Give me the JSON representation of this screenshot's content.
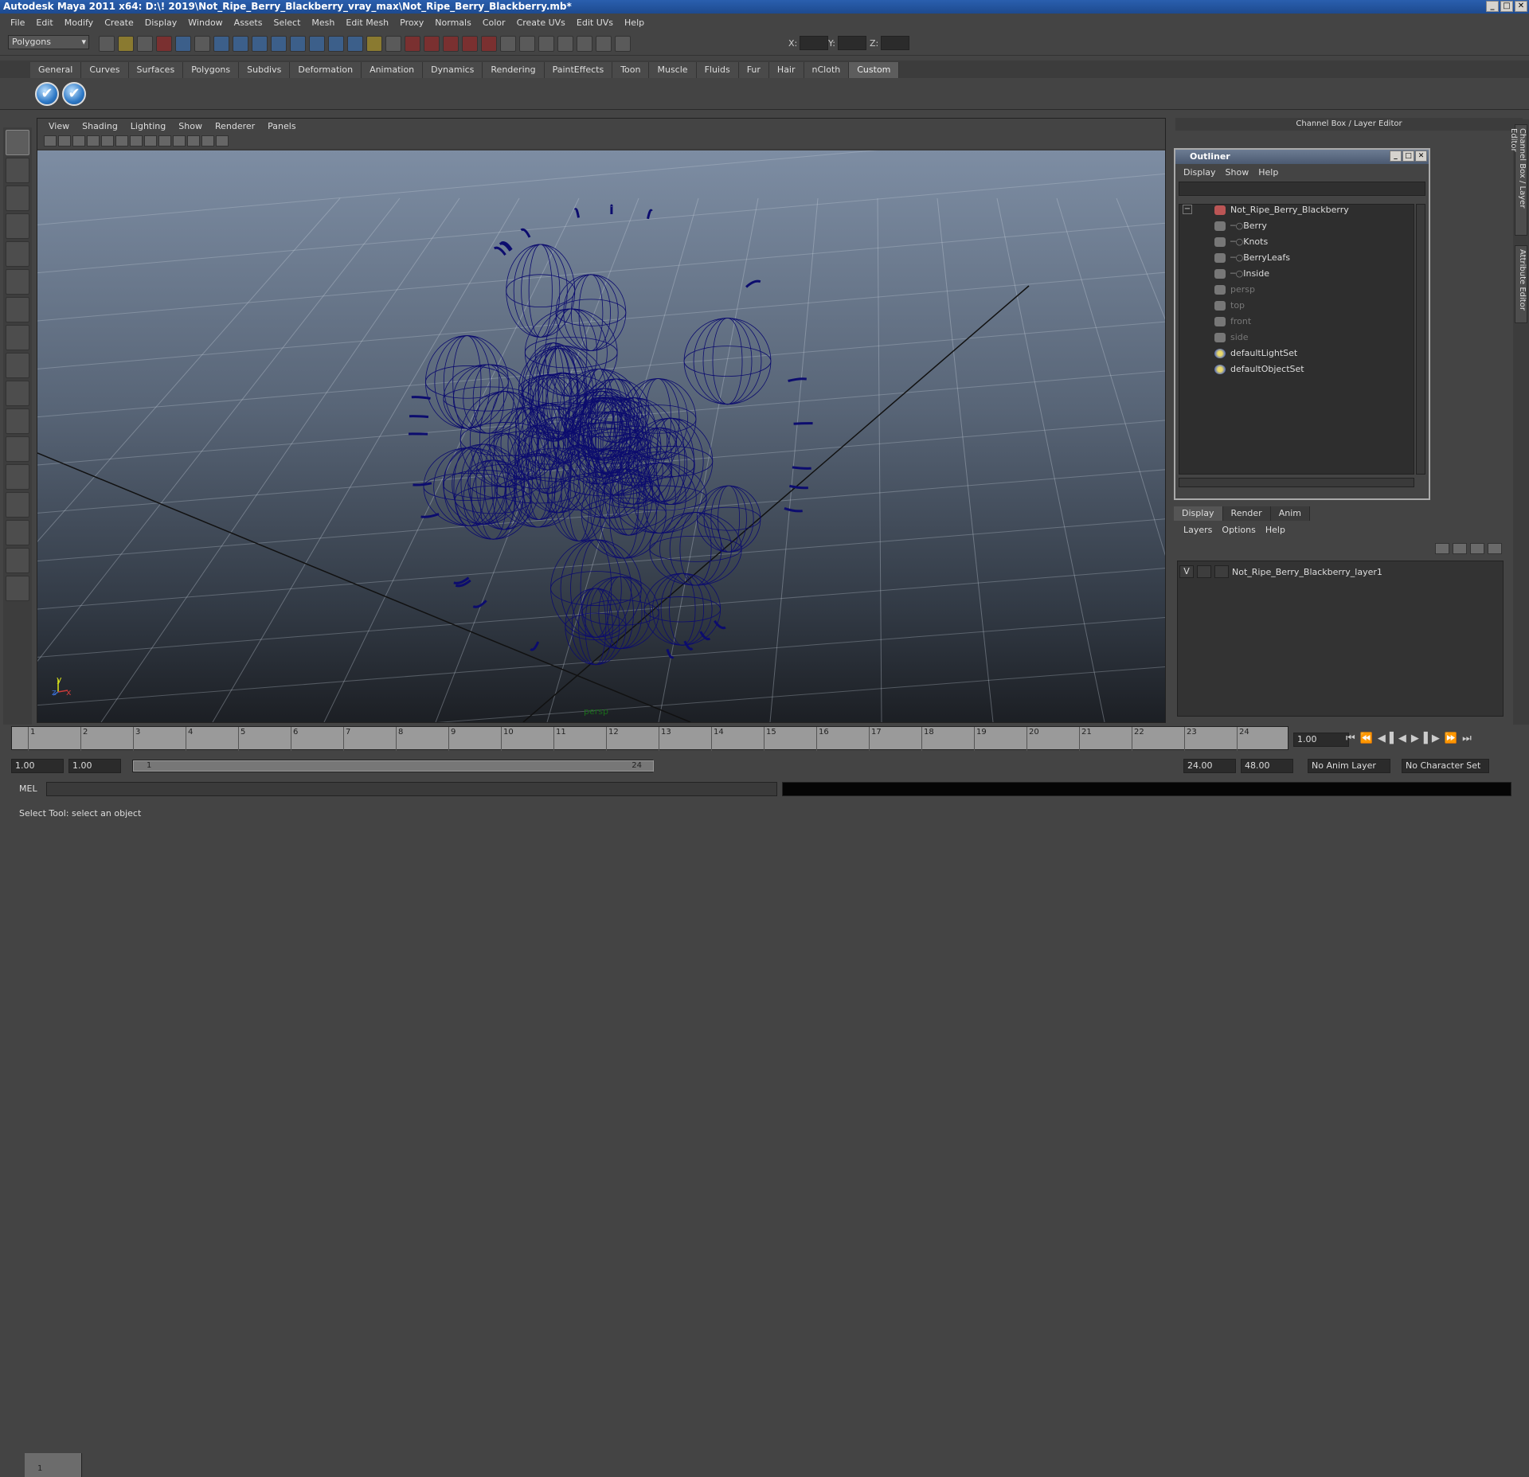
{
  "window": {
    "title": "Autodesk Maya 2011 x64: D:\\! 2019\\Not_Ripe_Berry_Blackberry_vray_max\\Not_Ripe_Berry_Blackberry.mb*",
    "min": "_",
    "max": "□",
    "close": "✕"
  },
  "menu": [
    "File",
    "Edit",
    "Modify",
    "Create",
    "Display",
    "Window",
    "Assets",
    "Select",
    "Mesh",
    "Edit Mesh",
    "Proxy",
    "Normals",
    "Color",
    "Create UVs",
    "Edit UVs",
    "Help"
  ],
  "status": {
    "mode": "Polygons",
    "x_label": "X:",
    "y_label": "Y:",
    "z_label": "Z:"
  },
  "shelf": {
    "tabs": [
      "General",
      "Curves",
      "Surfaces",
      "Polygons",
      "Subdivs",
      "Deformation",
      "Animation",
      "Dynamics",
      "Rendering",
      "PaintEffects",
      "Toon",
      "Muscle",
      "Fluids",
      "Fur",
      "Hair",
      "nCloth",
      "Custom"
    ],
    "active": "Custom",
    "buttons": [
      "✔",
      "✔"
    ]
  },
  "viewport": {
    "menu": [
      "View",
      "Shading",
      "Lighting",
      "Show",
      "Renderer",
      "Panels"
    ],
    "camera": "persp",
    "axis_y": "y",
    "axis_x": "x",
    "axis_z": "z",
    "wire_color": "#0c0c6e"
  },
  "channel_box_title": "Channel Box / Layer Editor",
  "outliner": {
    "title": "Outliner",
    "menu": [
      "Display",
      "Show",
      "Help"
    ],
    "items": [
      {
        "label": "Not_Ripe_Berry_Blackberry",
        "dim": false
      },
      {
        "label": "Berry",
        "dim": false
      },
      {
        "label": "Knots",
        "dim": false
      },
      {
        "label": "BerryLeafs",
        "dim": false
      },
      {
        "label": "Inside",
        "dim": false
      },
      {
        "label": "persp",
        "dim": true
      },
      {
        "label": "top",
        "dim": true
      },
      {
        "label": "front",
        "dim": true
      },
      {
        "label": "side",
        "dim": true
      },
      {
        "label": "defaultLightSet",
        "dim": false
      },
      {
        "label": "defaultObjectSet",
        "dim": false
      }
    ],
    "expander": "−"
  },
  "layers": {
    "tabs": [
      "Display",
      "Render",
      "Anim"
    ],
    "active": "Display",
    "menu": [
      "Layers",
      "Options",
      "Help"
    ],
    "row": {
      "visible": "V",
      "name": "Not_Ripe_Berry_Blackberry_layer1"
    }
  },
  "side_tabs": [
    "Channel Box / Layer Editor",
    "Attribute Editor"
  ],
  "timeline": {
    "ticks": [
      "1",
      "2",
      "3",
      "4",
      "5",
      "6",
      "7",
      "8",
      "9",
      "10",
      "11",
      "12",
      "13",
      "14",
      "15",
      "16",
      "17",
      "18",
      "19",
      "20",
      "21",
      "22",
      "23",
      "24"
    ],
    "current_marker": "1",
    "current_time": "1.00"
  },
  "range": {
    "start": "1.00",
    "anim_start": "1.00",
    "slider_start": "1",
    "slider_end": "24",
    "end": "24.00",
    "anim_end": "48.00",
    "anim_layer": "No Anim Layer",
    "char_set": "No Character Set"
  },
  "command": {
    "label": "MEL"
  },
  "help_line": "Select Tool: select an object"
}
